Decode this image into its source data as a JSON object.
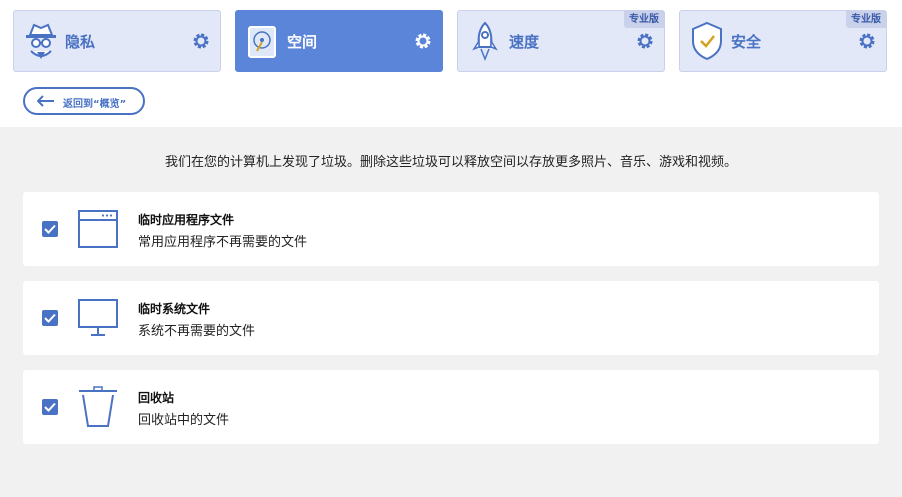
{
  "tabs": [
    {
      "label": "隐私",
      "icon": "spy-icon",
      "active": false,
      "badge": ""
    },
    {
      "label": "空间",
      "icon": "disk-icon",
      "active": true,
      "badge": ""
    },
    {
      "label": "速度",
      "icon": "rocket-icon",
      "active": false,
      "badge": "专业版"
    },
    {
      "label": "安全",
      "icon": "shield-icon",
      "active": false,
      "badge": "专业版"
    }
  ],
  "back_label": "返回到“概览”",
  "intro": "我们在您的计算机上发现了垃圾。删除这些垃圾可以释放空间以存放更多照片、音乐、游戏和视频。",
  "items": [
    {
      "title": "临时应用程序文件",
      "desc": "常用应用程序不再需要的文件",
      "checked": true,
      "icon": "app-window-icon"
    },
    {
      "title": "临时系统文件",
      "desc": "系统不再需要的文件",
      "checked": true,
      "icon": "monitor-icon"
    },
    {
      "title": "回收站",
      "desc": "回收站中的文件",
      "checked": true,
      "icon": "trash-icon"
    }
  ],
  "colors": {
    "accent": "#5a85d8",
    "tab_bg": "#e2e8f7",
    "content_bg": "#f1f1f1"
  }
}
